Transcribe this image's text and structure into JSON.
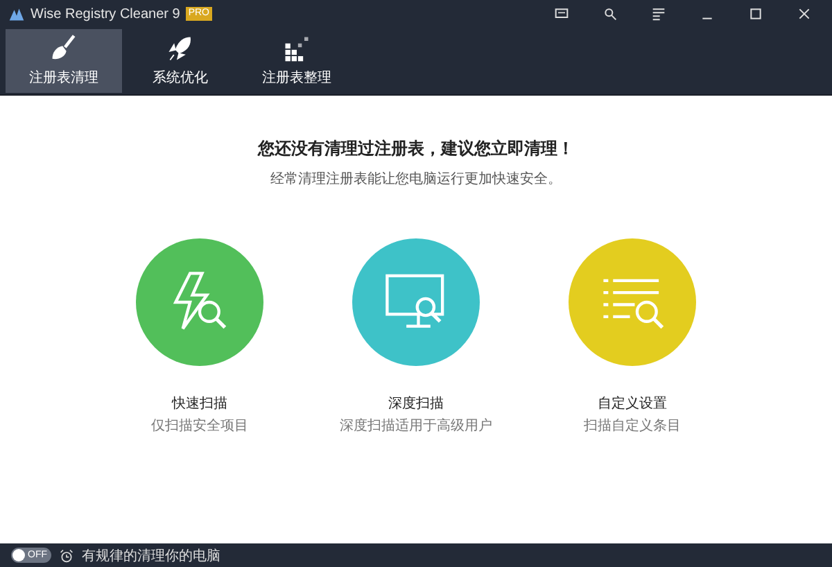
{
  "window": {
    "title": "Wise Registry Cleaner 9",
    "badge": "PRO"
  },
  "tabs": [
    {
      "label": "注册表清理",
      "kind": "cleaner",
      "selected": true
    },
    {
      "label": "系统优化",
      "kind": "optimizer",
      "selected": false
    },
    {
      "label": "注册表整理",
      "kind": "defrag",
      "selected": false
    }
  ],
  "headline": "您还没有清理过注册表，建议您立即清理！",
  "subline": "经常清理注册表能让您电脑运行更加快速安全。",
  "scan_options": [
    {
      "kind": "fast",
      "title": "快速扫描",
      "description": "仅扫描安全项目",
      "color": "#52bf5a"
    },
    {
      "kind": "deep",
      "title": "深度扫描",
      "description": "深度扫描适用于高级用户",
      "color": "#3ec2c8"
    },
    {
      "kind": "custom",
      "title": "自定义设置",
      "description": "扫描自定义条目",
      "color": "#e3cd1f"
    }
  ],
  "status_bar": {
    "toggle": {
      "label": "OFF",
      "on": false
    },
    "text": "有规律的清理你的电脑"
  }
}
